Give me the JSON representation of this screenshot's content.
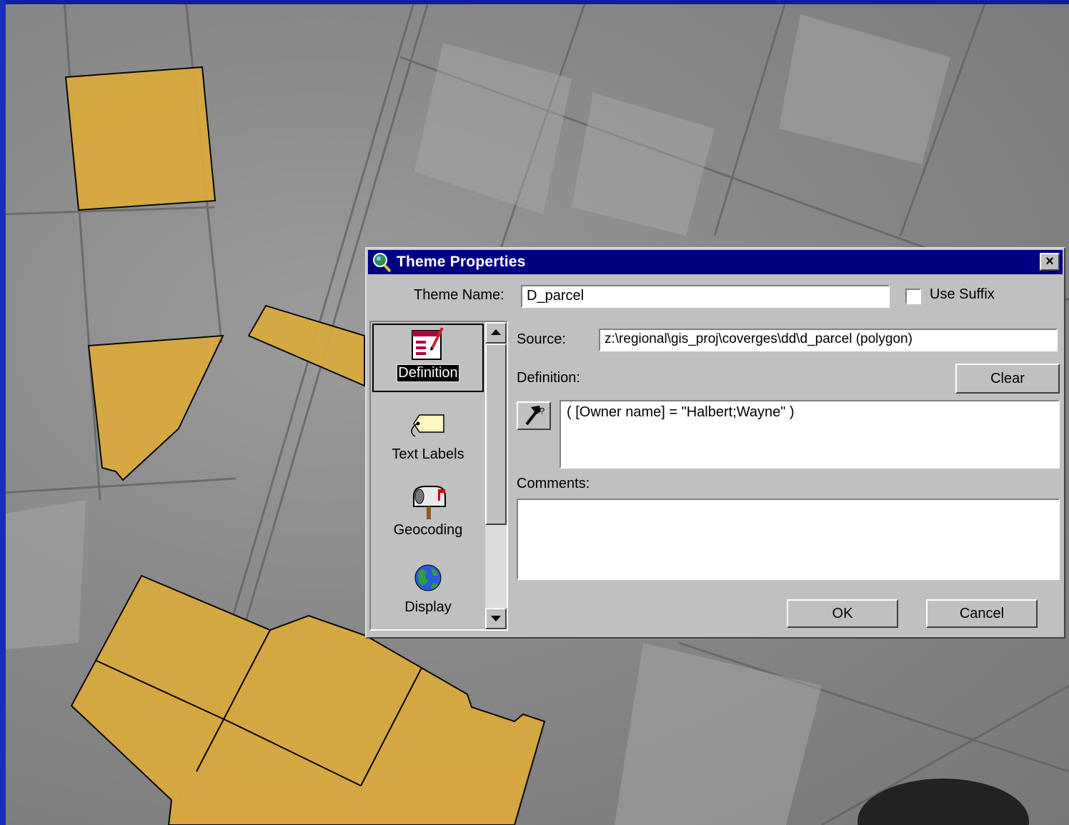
{
  "window": {
    "title": "Theme Properties",
    "close_glyph": "×"
  },
  "theme_name": {
    "label": "Theme Name:",
    "value": "D_parcel",
    "use_suffix_label": "Use Suffix",
    "use_suffix_checked": false
  },
  "categories": [
    {
      "label": "Definition",
      "icon": "definition-icon",
      "selected": true
    },
    {
      "label": "Text Labels",
      "icon": "tag-icon",
      "selected": false
    },
    {
      "label": "Geocoding",
      "icon": "mailbox-icon",
      "selected": false
    },
    {
      "label": "Display",
      "icon": "globe-icon",
      "selected": false
    }
  ],
  "source": {
    "label": "Source:",
    "value": "z:\\regional\\gis_proj\\coverges\\dd\\d_parcel (polygon)"
  },
  "definition": {
    "label": "Definition:",
    "clear_label": "Clear",
    "expression": "( [Owner name] = \"Halbert;Wayne\" )",
    "query_builder_icon": "hammer-query-icon"
  },
  "comments": {
    "label": "Comments:",
    "value": ""
  },
  "buttons": {
    "ok_label": "OK",
    "cancel_label": "Cancel"
  },
  "colors": {
    "titlebar": "#000080",
    "dialog_face": "#c0c0c0",
    "parcel_fill": "#d9aa3d",
    "background_edge": "#1a2fb8"
  }
}
